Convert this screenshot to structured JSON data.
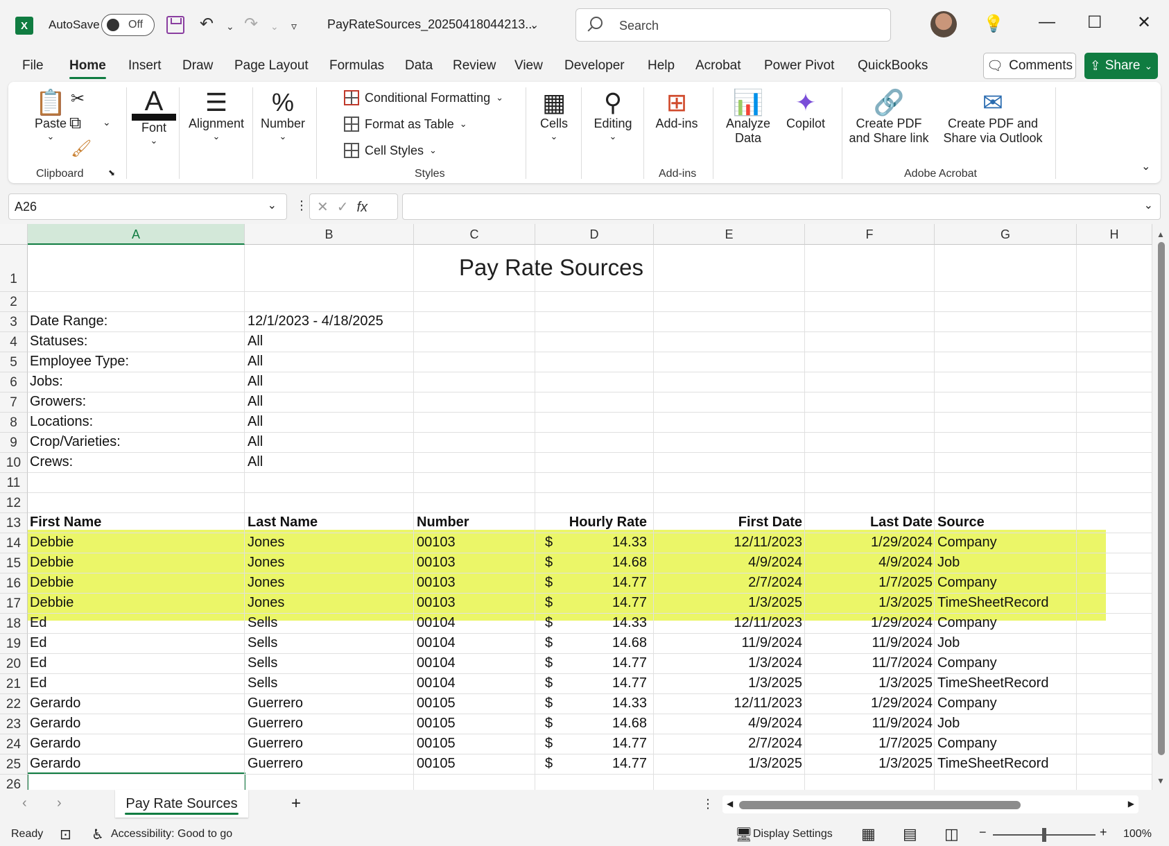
{
  "titlebar": {
    "app_logo": "X",
    "autosave_label": "AutoSave",
    "autosave_state": "Off",
    "filename": "PayRateSources_20250418044213...",
    "search_placeholder": "Search"
  },
  "menu": {
    "tabs": [
      "File",
      "Home",
      "Insert",
      "Draw",
      "Page Layout",
      "Formulas",
      "Data",
      "Review",
      "View",
      "Developer",
      "Help",
      "Acrobat",
      "Power Pivot",
      "QuickBooks"
    ],
    "active": "Home",
    "comments_label": "Comments",
    "share_label": "Share"
  },
  "ribbon": {
    "paste": "Paste",
    "clipboard": "Clipboard",
    "font": "Font",
    "alignment": "Alignment",
    "number": "Number",
    "conditional_formatting": "Conditional Formatting",
    "format_as_table": "Format as Table",
    "cell_styles": "Cell Styles",
    "styles": "Styles",
    "cells": "Cells",
    "editing": "Editing",
    "addins": "Add-ins",
    "addins_group": "Add-ins",
    "analyze_line1": "Analyze",
    "analyze_line2": "Data",
    "copilot": "Copilot",
    "create_pdf_link_l1": "Create PDF",
    "create_pdf_link_l2": "and Share link",
    "create_pdf_outlook_l1": "Create PDF and",
    "create_pdf_outlook_l2": "Share via Outlook",
    "adobe_acrobat": "Adobe Acrobat"
  },
  "formula_bar": {
    "name_box": "A26",
    "fx": "fx",
    "content": ""
  },
  "columns": [
    "A",
    "B",
    "C",
    "D",
    "E",
    "F",
    "G",
    "H"
  ],
  "rows": [
    "1",
    "2",
    "3",
    "4",
    "5",
    "6",
    "7",
    "8",
    "9",
    "10",
    "11",
    "12",
    "13",
    "14",
    "15",
    "16",
    "17",
    "18",
    "19",
    "20",
    "21",
    "22",
    "23",
    "24",
    "25",
    "26"
  ],
  "sheet": {
    "title": "Pay Rate Sources",
    "params": [
      {
        "label": "Date Range:",
        "value": "12/1/2023 - 4/18/2025"
      },
      {
        "label": "Statuses:",
        "value": "All"
      },
      {
        "label": "Employee Type:",
        "value": "All"
      },
      {
        "label": "Jobs:",
        "value": "All"
      },
      {
        "label": "Growers:",
        "value": "All"
      },
      {
        "label": "Locations:",
        "value": "All"
      },
      {
        "label": "Crop/Varieties:",
        "value": "All"
      },
      {
        "label": "Crews:",
        "value": "All"
      }
    ],
    "headers": [
      "First Name",
      "Last Name",
      "Number",
      "Hourly Rate",
      "First Date",
      "Last Date",
      "Source"
    ],
    "currency": "$",
    "data": [
      [
        "Debbie",
        "Jones",
        "00103",
        "14.33",
        "12/11/2023",
        "1/29/2024",
        "Company"
      ],
      [
        "Debbie",
        "Jones",
        "00103",
        "14.68",
        "4/9/2024",
        "4/9/2024",
        "Job"
      ],
      [
        "Debbie",
        "Jones",
        "00103",
        "14.77",
        "2/7/2024",
        "1/7/2025",
        "Company"
      ],
      [
        "Debbie",
        "Jones",
        "00103",
        "14.77",
        "1/3/2025",
        "1/3/2025",
        "TimeSheetRecord"
      ],
      [
        "Ed",
        "Sells",
        "00104",
        "14.33",
        "12/11/2023",
        "1/29/2024",
        "Company"
      ],
      [
        "Ed",
        "Sells",
        "00104",
        "14.68",
        "11/9/2024",
        "11/9/2024",
        "Job"
      ],
      [
        "Ed",
        "Sells",
        "00104",
        "14.77",
        "1/3/2024",
        "11/7/2024",
        "Company"
      ],
      [
        "Ed",
        "Sells",
        "00104",
        "14.77",
        "1/3/2025",
        "1/3/2025",
        "TimeSheetRecord"
      ],
      [
        "Gerardo",
        "Guerrero",
        "00105",
        "14.33",
        "12/11/2023",
        "1/29/2024",
        "Company"
      ],
      [
        "Gerardo",
        "Guerrero",
        "00105",
        "14.68",
        "4/9/2024",
        "11/9/2024",
        "Job"
      ],
      [
        "Gerardo",
        "Guerrero",
        "00105",
        "14.77",
        "2/7/2024",
        "1/7/2025",
        "Company"
      ],
      [
        "Gerardo",
        "Guerrero",
        "00105",
        "14.77",
        "1/3/2025",
        "1/3/2025",
        "TimeSheetRecord"
      ]
    ]
  },
  "sheet_tabs": {
    "active": "Pay Rate Sources",
    "add": "+"
  },
  "statusbar": {
    "ready": "Ready",
    "accessibility": "Accessibility: Good to go",
    "display_settings": "Display Settings",
    "zoom": "100%"
  },
  "colors": {
    "accent": "#107c41",
    "highlight": "#e8f54e"
  }
}
